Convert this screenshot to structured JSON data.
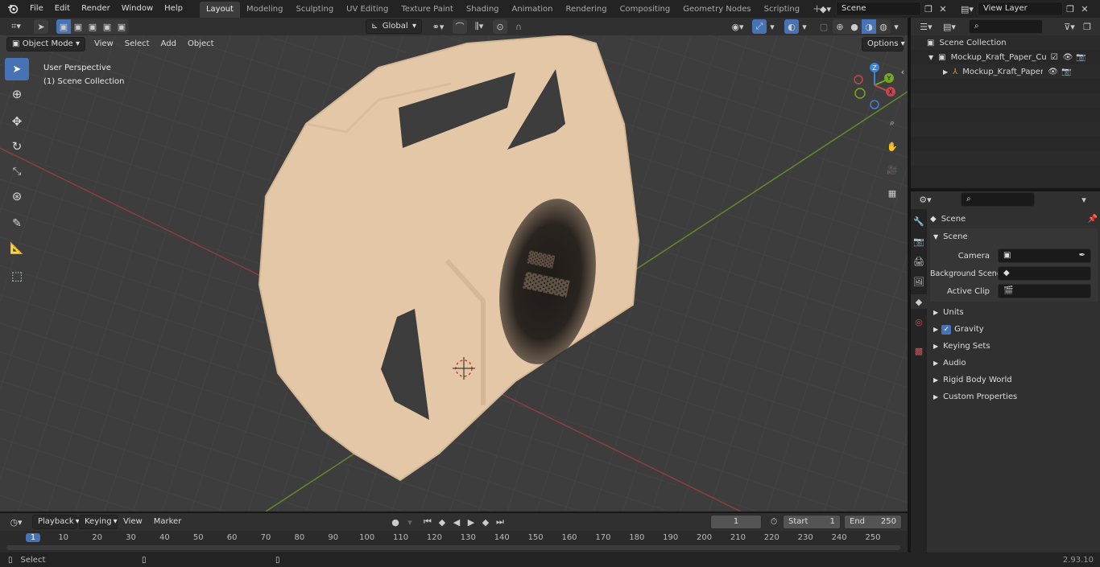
{
  "topbar": {
    "menus": [
      "File",
      "Edit",
      "Render",
      "Window",
      "Help"
    ],
    "workspaces": [
      "Layout",
      "Modeling",
      "Sculpting",
      "UV Editing",
      "Texture Paint",
      "Shading",
      "Animation",
      "Rendering",
      "Compositing",
      "Geometry Nodes",
      "Scripting"
    ],
    "active_workspace": "Layout",
    "scene_value": "Scene",
    "view_layer_value": "View Layer"
  },
  "viewport_header": {
    "mode": "Object Mode",
    "menus": [
      "View",
      "Select",
      "Add",
      "Object"
    ],
    "orientation": "Global",
    "options_label": "Options"
  },
  "viewport": {
    "perspective_label": "User Perspective",
    "collection_label": "(1) Scene Collection",
    "gizmo_axes": [
      "X",
      "Y",
      "Z"
    ]
  },
  "outliner": {
    "root": "Scene Collection",
    "items": [
      {
        "label": "Mockup_Kraft_Paper_Cup_Ho"
      },
      {
        "label": "Mockup_Kraft_Paper_Cup"
      }
    ]
  },
  "properties": {
    "context_title": "Scene",
    "panel_title": "Scene",
    "fields": [
      {
        "label": "Camera"
      },
      {
        "label": "Background Scene"
      },
      {
        "label": "Active Clip"
      }
    ],
    "sections": [
      "Units",
      "Gravity",
      "Keying Sets",
      "Audio",
      "Rigid Body World",
      "Custom Properties"
    ]
  },
  "timeline": {
    "menus": [
      "Playback",
      "Keying",
      "View",
      "Marker"
    ],
    "current_frame": "1",
    "start_label": "Start",
    "start_value": "1",
    "end_label": "End",
    "end_value": "250",
    "ruler": [
      "1",
      "10",
      "20",
      "30",
      "40",
      "50",
      "60",
      "70",
      "80",
      "90",
      "100",
      "110",
      "120",
      "130",
      "140",
      "150",
      "160",
      "170",
      "180",
      "190",
      "200",
      "210",
      "220",
      "230",
      "240",
      "250"
    ]
  },
  "statusbar": {
    "left_label": "Select",
    "version": "2.93.10"
  },
  "colors": {
    "accent": "#4772b3",
    "x_axis": "#c2474d",
    "y_axis": "#76a626",
    "z_axis": "#3f82d6",
    "object_fill": "#e3c7a7"
  }
}
